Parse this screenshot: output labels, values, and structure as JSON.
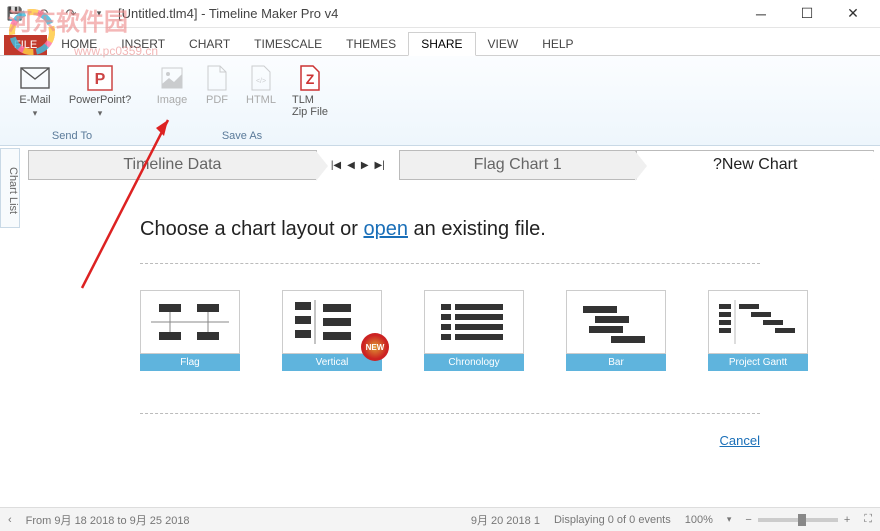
{
  "titlebar": {
    "doc": "[Untitled.tlm4]",
    "sep": " - ",
    "app": "Timeline Maker Pro v4"
  },
  "menu": {
    "file": "FILE",
    "items": [
      "HOME",
      "INSERT",
      "CHART",
      "TIMESCALE",
      "THEMES",
      "SHARE",
      "VIEW",
      "HELP"
    ],
    "active_index": 5
  },
  "ribbon": {
    "send_to": {
      "email": "E-Mail",
      "powerpoint": "PowerPoint?",
      "label": "Send To"
    },
    "save_as": {
      "image": "Image",
      "pdf": "PDF",
      "html": "HTML",
      "tlm": "TLM\nZip File",
      "label": "Save As"
    }
  },
  "side_tab": "Chart List",
  "tabs": {
    "data": "Timeline Data",
    "flag": "Flag Chart 1",
    "new": "?New Chart"
  },
  "content": {
    "heading_a": "Choose a chart layout or ",
    "heading_link": "open",
    "heading_b": " an existing file.",
    "layouts": [
      "Flag",
      "Vertical",
      "Chronology",
      "Bar",
      "Project Gantt"
    ],
    "new_badge": "NEW",
    "cancel": "Cancel"
  },
  "status": {
    "range": "From 9月 18 2018 to 9月 25 2018",
    "date": "9月 20 2018 1",
    "events": "Displaying 0 of 0 events",
    "zoom": "100%"
  },
  "watermark": {
    "text": "河东软件园",
    "url": "www.pc0359.cn"
  }
}
